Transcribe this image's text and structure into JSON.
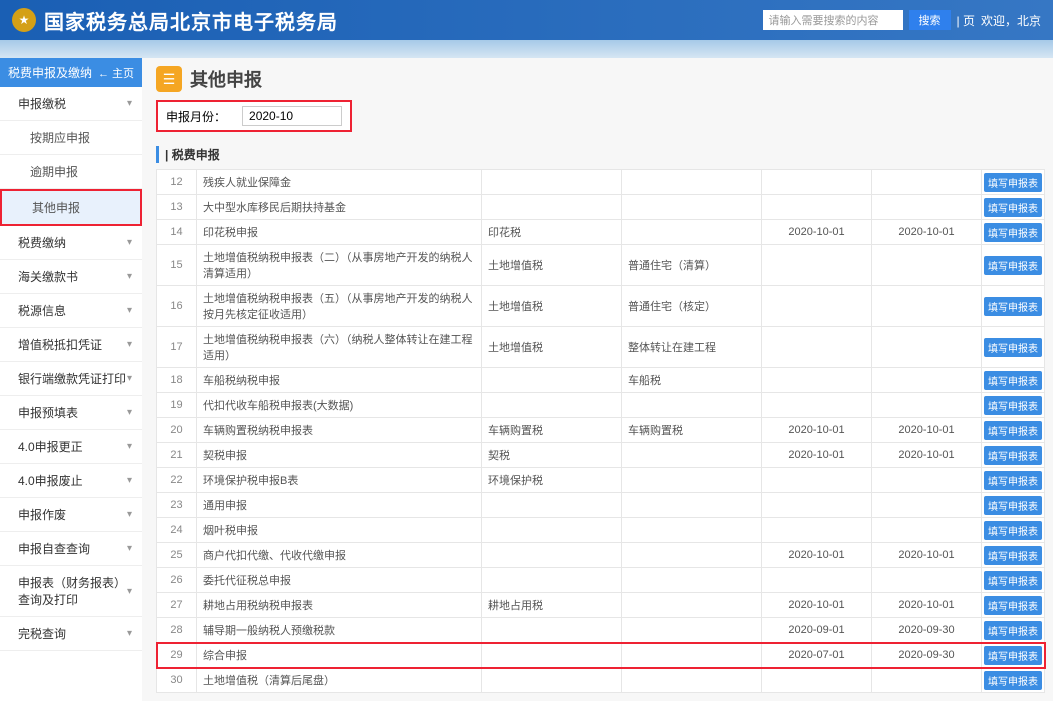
{
  "header": {
    "title": "国家税务总局北京市电子税务局",
    "search_placeholder": "请输入需要搜索的内容",
    "search_btn": "搜索",
    "links": [
      "| 页",
      "欢迎，北京"
    ]
  },
  "sidebar": {
    "header": "税费申报及缴纳",
    "return": "← 主页",
    "items": [
      {
        "label": "申报缴税",
        "chev": "▾",
        "lv": 1
      },
      {
        "label": "按期应申报",
        "lv": 2
      },
      {
        "label": "逾期申报",
        "lv": 2
      },
      {
        "label": "其他申报",
        "lv": 2,
        "active": true,
        "red": true
      },
      {
        "label": "税费缴纳",
        "chev": "▾",
        "lv": 1
      },
      {
        "label": "海关缴款书",
        "chev": "▾",
        "lv": 1
      },
      {
        "label": "税源信息",
        "chev": "▾",
        "lv": 1
      },
      {
        "label": "增值税抵扣凭证",
        "chev": "▾",
        "lv": 1
      },
      {
        "label": "银行端缴款凭证打印",
        "chev": "▾",
        "lv": 1
      },
      {
        "label": "申报预填表",
        "chev": "▾",
        "lv": 1
      },
      {
        "label": "4.0申报更正",
        "chev": "▾",
        "lv": 1
      },
      {
        "label": "4.0申报废止",
        "chev": "▾",
        "lv": 1
      },
      {
        "label": "申报作废",
        "chev": "▾",
        "lv": 1
      },
      {
        "label": "申报自查查询",
        "chev": "▾",
        "lv": 1
      },
      {
        "label": "申报表（财务报表）查询及打印",
        "chev": "▾",
        "lv": 1
      },
      {
        "label": "完税查询",
        "chev": "▾",
        "lv": 1
      }
    ]
  },
  "page": {
    "title": "其他申报",
    "period_label": "申报月份：",
    "period_value": "2020-10",
    "section": "| 税费申报"
  },
  "rows": [
    {
      "n": "12",
      "name": "残疾人就业保障金",
      "c3": "",
      "c4": "",
      "d1": "",
      "d2": "",
      "btn": "填写申报表"
    },
    {
      "n": "13",
      "name": "大中型水库移民后期扶持基金",
      "c3": "",
      "c4": "",
      "d1": "",
      "d2": "",
      "btn": "填写申报表"
    },
    {
      "n": "14",
      "name": "印花税申报",
      "c3": "印花税",
      "c4": "",
      "d1": "2020-10-01",
      "d2": "2020-10-01",
      "btn": "填写申报表"
    },
    {
      "n": "15",
      "name": "土地增值税纳税申报表（二）（从事房地产开发的纳税人清算适用）",
      "c3": "土地增值税",
      "c4": "普通住宅（清算）",
      "d1": "",
      "d2": "",
      "btn": "填写申报表"
    },
    {
      "n": "16",
      "name": "土地增值税纳税申报表（五）（从事房地产开发的纳税人按月先核定征收适用）",
      "c3": "土地增值税",
      "c4": "普通住宅（核定）",
      "d1": "",
      "d2": "",
      "btn": "填写申报表"
    },
    {
      "n": "17",
      "name": "土地增值税纳税申报表（六）（纳税人整体转让在建工程适用）",
      "c3": "土地增值税",
      "c4": "整体转让在建工程",
      "d1": "",
      "d2": "",
      "btn": "填写申报表"
    },
    {
      "n": "18",
      "name": "车船税纳税申报",
      "c3": "",
      "c4": "车船税",
      "d1": "",
      "d2": "",
      "btn": "填写申报表"
    },
    {
      "n": "19",
      "name": "代扣代收车船税申报表(大数据)",
      "c3": "",
      "c4": "",
      "d1": "",
      "d2": "",
      "btn": "填写申报表"
    },
    {
      "n": "20",
      "name": "车辆购置税纳税申报表",
      "c3": "车辆购置税",
      "c4": "车辆购置税",
      "d1": "2020-10-01",
      "d2": "2020-10-01",
      "btn": "填写申报表"
    },
    {
      "n": "21",
      "name": "契税申报",
      "c3": "契税",
      "c4": "",
      "d1": "2020-10-01",
      "d2": "2020-10-01",
      "btn": "填写申报表"
    },
    {
      "n": "22",
      "name": "环境保护税申报B表",
      "c3": "环境保护税",
      "c4": "",
      "d1": "",
      "d2": "",
      "btn": "填写申报表"
    },
    {
      "n": "23",
      "name": "通用申报",
      "c3": "",
      "c4": "",
      "d1": "",
      "d2": "",
      "btn": "填写申报表"
    },
    {
      "n": "24",
      "name": "烟叶税申报",
      "c3": "",
      "c4": "",
      "d1": "",
      "d2": "",
      "btn": "填写申报表"
    },
    {
      "n": "25",
      "name": "商户代扣代缴、代收代缴申报",
      "c3": "",
      "c4": "",
      "d1": "2020-10-01",
      "d2": "2020-10-01",
      "btn": "填写申报表"
    },
    {
      "n": "26",
      "name": "委托代征税总申报",
      "c3": "",
      "c4": "",
      "d1": "",
      "d2": "",
      "btn": "填写申报表"
    },
    {
      "n": "27",
      "name": "耕地占用税纳税申报表",
      "c3": "耕地占用税",
      "c4": "",
      "d1": "2020-10-01",
      "d2": "2020-10-01",
      "btn": "填写申报表"
    },
    {
      "n": "28",
      "name": "辅导期一般纳税人预缴税款",
      "c3": "",
      "c4": "",
      "d1": "2020-09-01",
      "d2": "2020-09-30",
      "btn": "填写申报表"
    },
    {
      "n": "29",
      "name": "综合申报",
      "c3": "",
      "c4": "",
      "d1": "2020-07-01",
      "d2": "2020-09-30",
      "btn": "填写申报表",
      "hl": true
    },
    {
      "n": "30",
      "name": "土地增值税（清算后尾盘）",
      "c3": "",
      "c4": "",
      "d1": "",
      "d2": "",
      "btn": "填写申报表"
    }
  ]
}
